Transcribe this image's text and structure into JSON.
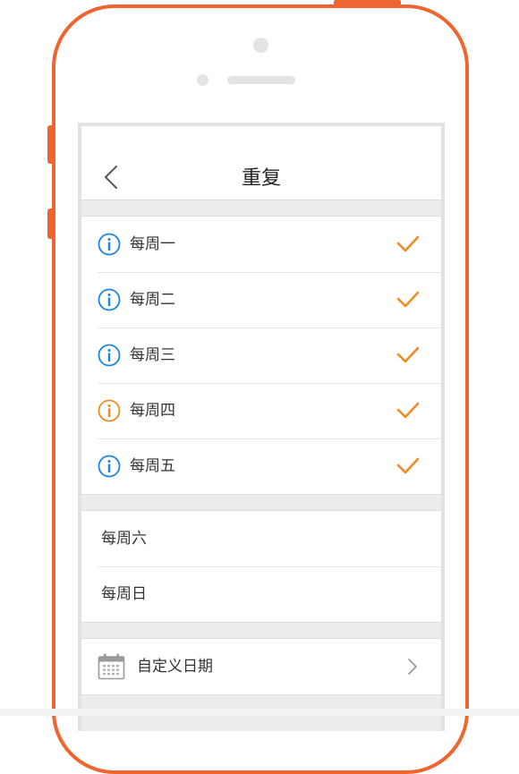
{
  "colors": {
    "frame": "#ef6530",
    "accent_check": "#f28a1e",
    "info_blue": "#1a86e0",
    "info_orange": "#f28a1e"
  },
  "navbar": {
    "back_icon": "chevron-left-icon",
    "title": "重复"
  },
  "weekdays": [
    {
      "label": "每周一",
      "icon": "info-icon",
      "icon_color": "#1a86e0",
      "checked": true
    },
    {
      "label": "每周二",
      "icon": "info-icon",
      "icon_color": "#1a86e0",
      "checked": true
    },
    {
      "label": "每周三",
      "icon": "info-icon",
      "icon_color": "#1a86e0",
      "checked": true
    },
    {
      "label": "每周四",
      "icon": "info-icon",
      "icon_color": "#f28a1e",
      "checked": true
    },
    {
      "label": "每周五",
      "icon": "info-icon",
      "icon_color": "#1a86e0",
      "checked": true
    }
  ],
  "weekend": [
    {
      "label": "每周六",
      "checked": false
    },
    {
      "label": "每周日",
      "checked": false
    }
  ],
  "custom": {
    "icon": "calendar-icon",
    "label": "自定义日期",
    "trailing_icon": "chevron-right-icon"
  }
}
